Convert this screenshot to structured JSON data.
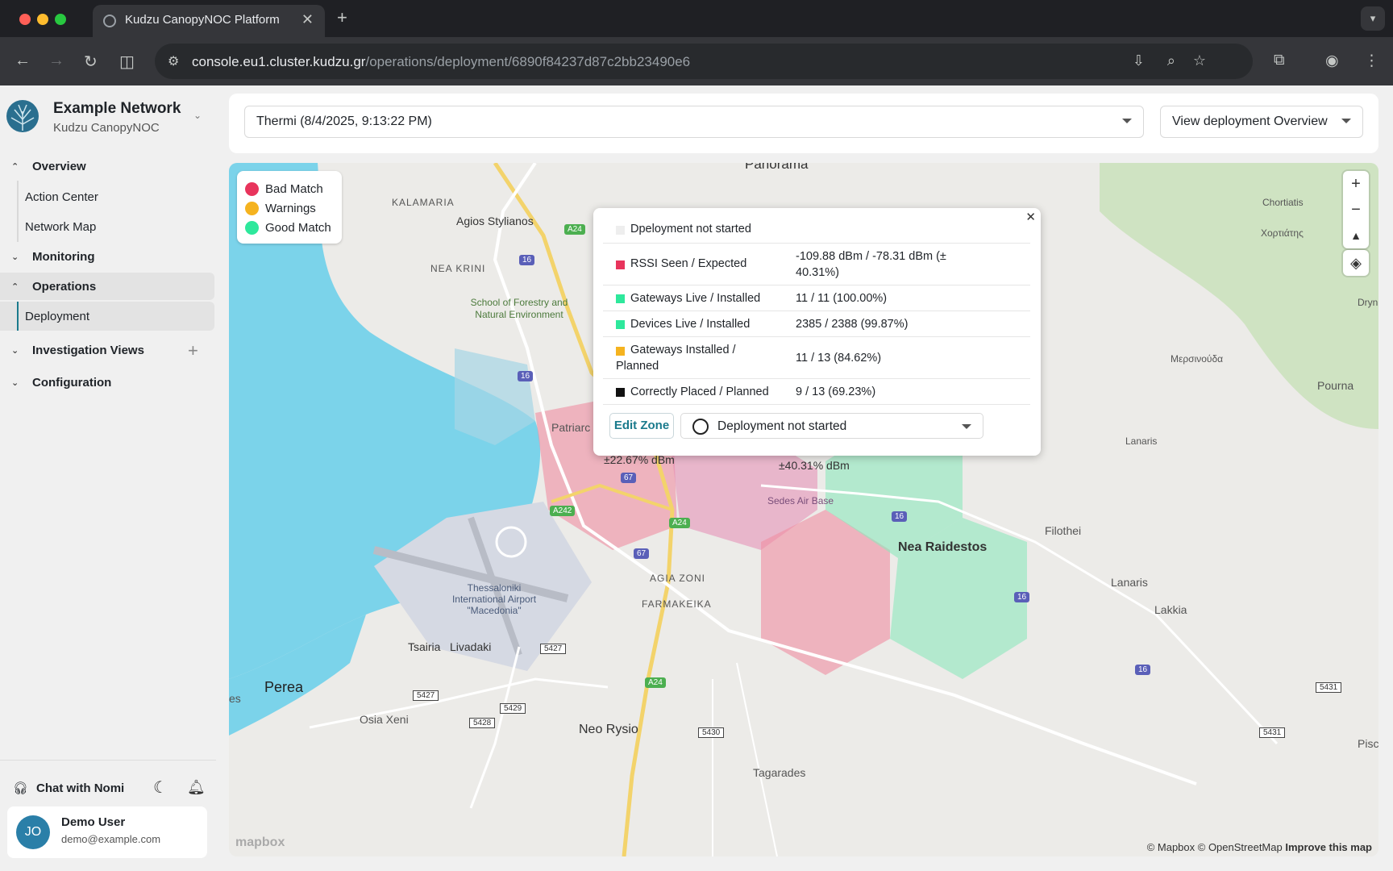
{
  "browser": {
    "tab_title": "Kudzu CanopyNOC Platform",
    "url_host": "console.eu1.cluster.kudzu.gr",
    "url_path": "/operations/deployment/6890f84237d87c2bb23490e6"
  },
  "sidebar": {
    "org_name": "Example Network",
    "org_sub": "Kudzu CanopyNOC",
    "sections": {
      "overview": "Overview",
      "action_center": "Action Center",
      "network_map": "Network Map",
      "monitoring": "Monitoring",
      "operations": "Operations",
      "deployment": "Deployment",
      "investigation_views": "Investigation Views",
      "configuration": "Configuration"
    },
    "chat_label": "Chat with Nomi",
    "user": {
      "initials": "JO",
      "name": "Demo User",
      "email": "demo@example.com"
    }
  },
  "header": {
    "zone_select": "Thermi (8/4/2025, 9:13:22 PM)",
    "view_button": "View deployment Overview"
  },
  "legend": {
    "items": [
      {
        "label": "Bad Match",
        "color": "#e8345c"
      },
      {
        "label": "Warnings",
        "color": "#f5b31f"
      },
      {
        "label": "Good Match",
        "color": "#2ee89c"
      }
    ]
  },
  "popup": {
    "title": "Dpeloyment not started",
    "rows": [
      {
        "label": "RSSI Seen / Expected",
        "value": "-109.88 dBm / -78.31 dBm (± 40.31%)",
        "color": "#e8345c"
      },
      {
        "label": "Gateways Live / Installed",
        "value": "11 / 11 (100.00%)",
        "color": "#2ee89c"
      },
      {
        "label": "Devices Live / Installed",
        "value": "2385 / 2388 (99.87%)",
        "color": "#2ee89c"
      },
      {
        "label": "Gateways Installed / Planned",
        "value": "11 / 13 (84.62%)",
        "color": "#f5b31f"
      },
      {
        "label": "Correctly Placed / Planned",
        "value": "9 / 13 (69.23%)",
        "color": "#111111"
      }
    ],
    "edit_button": "Edit Zone",
    "status_select": "Deployment not started"
  },
  "map": {
    "labels": {
      "panorama": "Panorama",
      "kalamaria": "KALAMARIA",
      "agios": "Agios Stylianos",
      "neakrini": "NEA KRINI",
      "forestry": "School of Forestry and Natural Environment",
      "patriarch": "Patriarc",
      "hex1": "±22.67% dBm",
      "hex2": "±40.31% dBm",
      "sedes": "Sedes Air Base",
      "nearaidestos": "Nea Raidestos",
      "filothei": "Filothei",
      "lanaris": "Lanaris",
      "lanaris2": "Lanaris",
      "chortiatis": "Chortiatis",
      "chortiatis_gr": "Χορτιάτης",
      "meroinouda": "Μερσινούδα",
      "pourna": "Pourna",
      "dryn": "Dryn",
      "airport": "Thessaloniki International Airport \"Macedonia\"",
      "agiazoni": "AGIA ZONI",
      "farmakeika": "FARMAKEIKA",
      "tsairia": "Tsairia",
      "livadaki": "Livadaki",
      "perea": "Perea",
      "osia": "Osia Xeni",
      "neorysio": "Neo Rysio",
      "lakkia": "Lakkia",
      "tagarades": "Tagarades",
      "pisc": "Pisc",
      "es": "es",
      "road_a24": "A24",
      "road_16": "16",
      "road_67": "67",
      "road_a242": "A242",
      "road_5427": "5427",
      "road_5429": "5429",
      "road_5428": "5428",
      "road_5430": "5430",
      "road_5431": "5431"
    },
    "attribution_1": "© Mapbox © OpenStreetMap",
    "attribution_2": "Improve this map",
    "mapbox_logo": "mapbox"
  }
}
